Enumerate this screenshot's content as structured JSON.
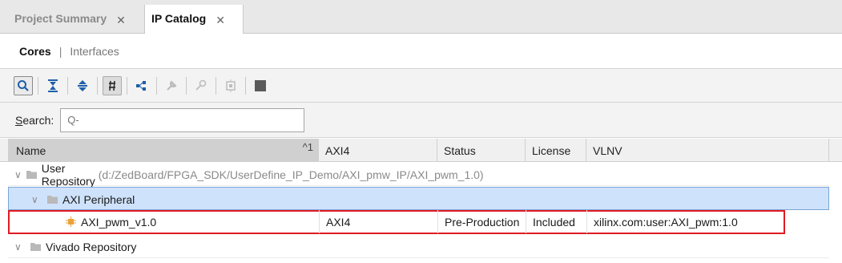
{
  "tabs": [
    {
      "label": "Project Summary",
      "active": false
    },
    {
      "label": "IP Catalog",
      "active": true
    }
  ],
  "subtabs": {
    "active": "Cores",
    "separator": "|",
    "inactive": "Interfaces"
  },
  "toolbar": {
    "icons": [
      "search-icon",
      "collapse-all-icon",
      "expand-all-icon",
      "group-by-icon",
      "hierarchy-icon",
      "customize-ip-icon",
      "license-key-icon",
      "ip-settings-icon",
      "stop-icon"
    ]
  },
  "search": {
    "label_first": "S",
    "label_rest": "earch:",
    "placeholder": "Q-",
    "value": ""
  },
  "table": {
    "columns": {
      "name": "Name",
      "sort_indicator": "^1",
      "axi": "AXI4",
      "status": "Status",
      "license": "License",
      "vlnv": "VLNV"
    },
    "rows": [
      {
        "name": "User Repository",
        "path": "(d:/ZedBoard/FPGA_SDK/UserDefine_IP_Demo/AXI_pmw_IP/AXI_pwm_1.0)"
      },
      {
        "name": "AXI Peripheral"
      },
      {
        "name": "AXI_pwm_v1.0",
        "axi": "AXI4",
        "status": "Pre-Production",
        "license": "Included",
        "vlnv": "xilinx.com:user:AXI_pwm:1.0"
      },
      {
        "name": "Vivado Repository"
      }
    ]
  },
  "colors": {
    "accent_highlight": "#e01b24",
    "selection": "#cfe2fb"
  }
}
